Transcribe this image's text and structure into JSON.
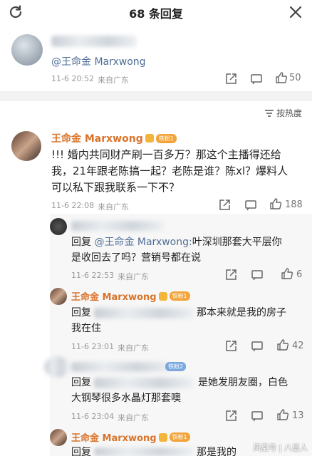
{
  "header": {
    "title": "68 条回复"
  },
  "original": {
    "mention": "@王命金 Marxwong",
    "time": "11-6 20:52",
    "location": "来自广东",
    "likes": "50"
  },
  "sort_label": "按热度",
  "main_comment": {
    "user": "王命金 Marxwong",
    "badge": "铁粉1",
    "text_lines": [
      "!!! 婚内共同财产刷一百多万？那这个主播得还给",
      "我，21年跟老陈搞一起？老陈是谁？陈xl？爆料人",
      "可以私下跟我联系一下不？"
    ],
    "time": "11-6 22:08",
    "location": "来自广东",
    "likes": "188"
  },
  "replies": [
    {
      "user_visible": "",
      "badge": "",
      "prefix": "回复",
      "mention": "@王命金 Marxwong:",
      "lines": [
        "叶深圳那套大平层你",
        "是收回去了吗？营销号都在说"
      ],
      "time": "11-6 22:53",
      "location": "来自广东",
      "likes": "6"
    },
    {
      "user_visible": "王命金 Marxwong",
      "badge": "铁粉1",
      "prefix": "回复",
      "mention": "",
      "lines": [
        "那本来就是我的房子",
        "我在住"
      ],
      "time": "11-6 23:01",
      "location": "来自广东",
      "likes": "42"
    },
    {
      "user_visible": "",
      "badge": "铁粉2",
      "prefix": "回复",
      "mention": "",
      "lines": [
        "是她发朋友圈，白色",
        "大钢琴很多水晶灯那套噢"
      ],
      "time": "11-6 23:04",
      "location": "来自广东",
      "likes": "13"
    },
    {
      "user_visible": "王命金 Marxwong",
      "badge": "铁粉1",
      "prefix": "回复",
      "mention": "",
      "lines": [
        "那是我的"
      ],
      "time": "",
      "location": "",
      "likes": ""
    }
  ],
  "watermark": "凤凰号 | 八星人",
  "icons": [
    "refresh-icon",
    "close-icon",
    "share-icon",
    "comment-icon",
    "like-icon",
    "sort-icon"
  ]
}
